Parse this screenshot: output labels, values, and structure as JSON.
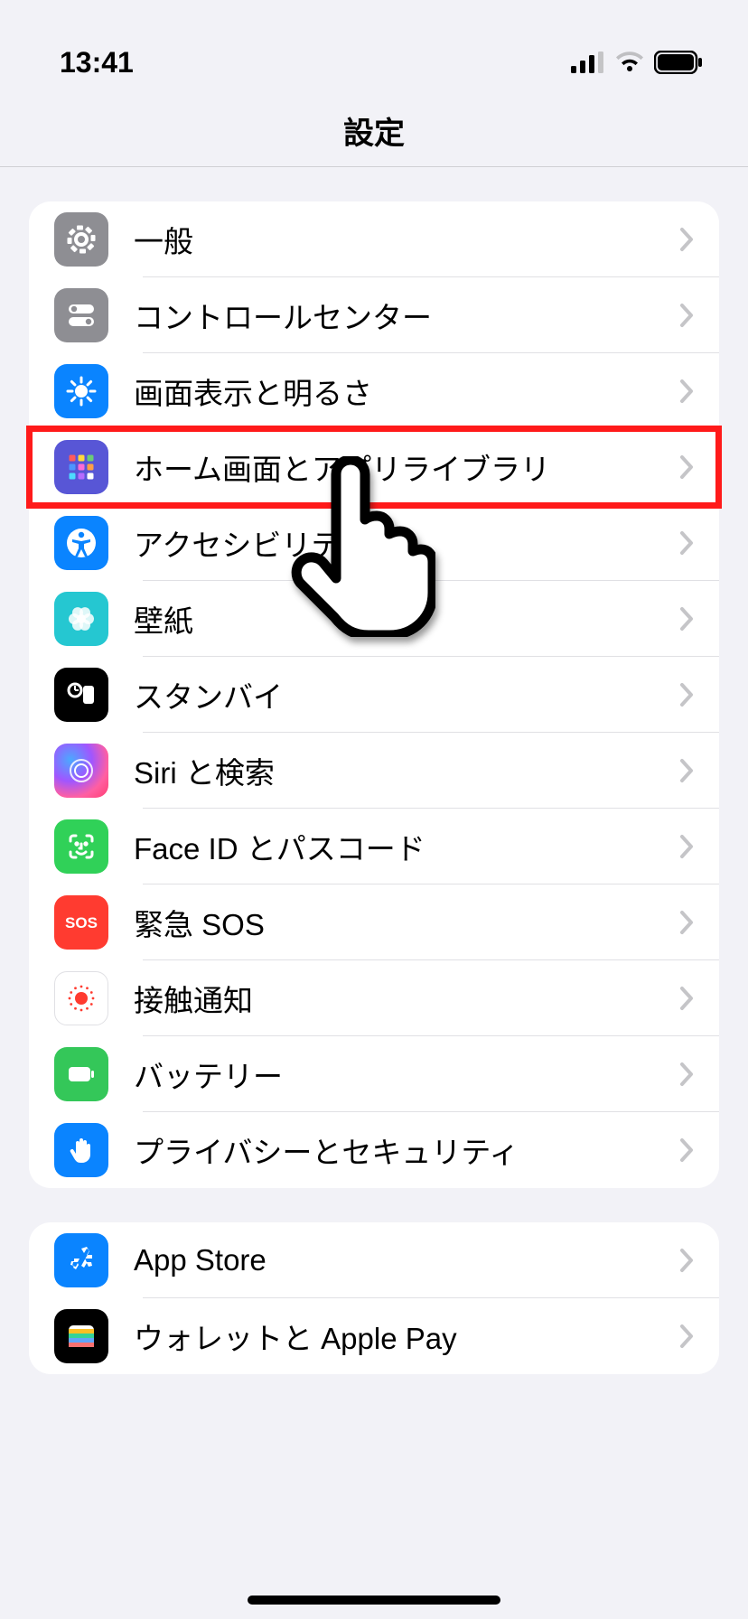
{
  "status": {
    "time": "13:41"
  },
  "header": {
    "title": "設定"
  },
  "groups": [
    {
      "items": [
        {
          "name": "general",
          "icon": "gear-icon",
          "bg": "bg-gray",
          "label": "一般"
        },
        {
          "name": "control-center",
          "icon": "switches-icon",
          "bg": "bg-switch",
          "label": "コントロールセンター"
        },
        {
          "name": "display-brightness",
          "icon": "sun-icon",
          "bg": "bg-blue",
          "label": "画面表示と明るさ"
        },
        {
          "name": "home-screen",
          "icon": "apps-grid-icon",
          "bg": "bg-indigo",
          "label": "ホーム画面とアプリライブラリ",
          "highlighted": true,
          "pointer": true
        },
        {
          "name": "accessibility",
          "icon": "accessibility-icon",
          "bg": "bg-blue",
          "label": "アクセシビリティ"
        },
        {
          "name": "wallpaper",
          "icon": "flower-icon",
          "bg": "bg-cyan",
          "label": "壁紙"
        },
        {
          "name": "standby",
          "icon": "standby-icon",
          "bg": "bg-black",
          "label": "スタンバイ"
        },
        {
          "name": "siri",
          "icon": "siri-icon",
          "bg": "bg-siri",
          "label": "Siri と検索"
        },
        {
          "name": "faceid-passcode",
          "icon": "faceid-icon",
          "bg": "bg-green",
          "label": "Face ID とパスコード"
        },
        {
          "name": "emergency-sos",
          "icon": "sos-icon",
          "bg": "bg-red",
          "label": "緊急 SOS"
        },
        {
          "name": "exposure-notif",
          "icon": "exposure-icon",
          "bg": "bg-white",
          "label": "接触通知"
        },
        {
          "name": "battery",
          "icon": "battery-icon",
          "bg": "bg-green2",
          "label": "バッテリー"
        },
        {
          "name": "privacy-security",
          "icon": "hand-icon",
          "bg": "bg-blue",
          "label": "プライバシーとセキュリティ"
        }
      ]
    },
    {
      "items": [
        {
          "name": "app-store",
          "icon": "appstore-icon",
          "bg": "bg-blue",
          "label": "App Store"
        },
        {
          "name": "wallet-pay",
          "icon": "wallet-icon",
          "bg": "bg-black",
          "label": "ウォレットと Apple Pay"
        }
      ]
    }
  ]
}
